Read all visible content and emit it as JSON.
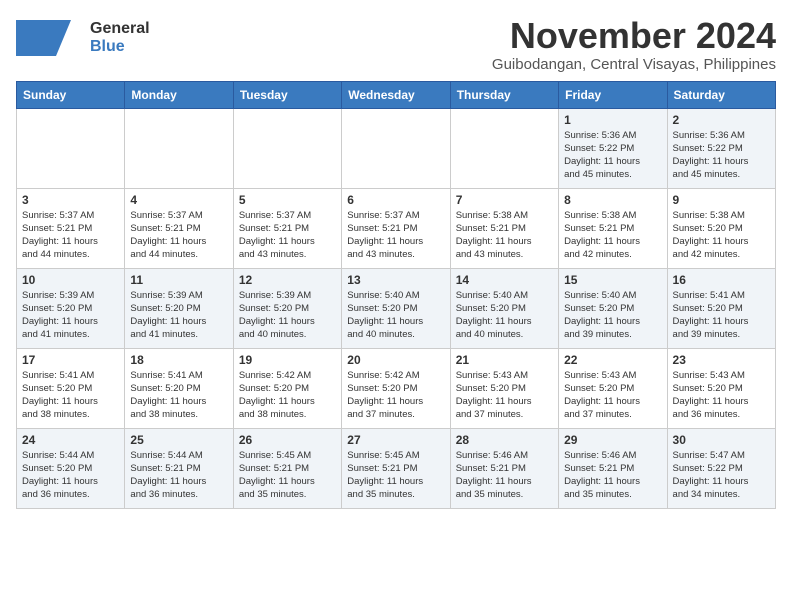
{
  "header": {
    "logo_general": "General",
    "logo_blue": "Blue",
    "month_title": "November 2024",
    "location": "Guibodangan, Central Visayas, Philippines"
  },
  "calendar": {
    "weekdays": [
      "Sunday",
      "Monday",
      "Tuesday",
      "Wednesday",
      "Thursday",
      "Friday",
      "Saturday"
    ],
    "weeks": [
      [
        {
          "day": "",
          "info": ""
        },
        {
          "day": "",
          "info": ""
        },
        {
          "day": "",
          "info": ""
        },
        {
          "day": "",
          "info": ""
        },
        {
          "day": "",
          "info": ""
        },
        {
          "day": "1",
          "info": "Sunrise: 5:36 AM\nSunset: 5:22 PM\nDaylight: 11 hours\nand 45 minutes."
        },
        {
          "day": "2",
          "info": "Sunrise: 5:36 AM\nSunset: 5:22 PM\nDaylight: 11 hours\nand 45 minutes."
        }
      ],
      [
        {
          "day": "3",
          "info": "Sunrise: 5:37 AM\nSunset: 5:21 PM\nDaylight: 11 hours\nand 44 minutes."
        },
        {
          "day": "4",
          "info": "Sunrise: 5:37 AM\nSunset: 5:21 PM\nDaylight: 11 hours\nand 44 minutes."
        },
        {
          "day": "5",
          "info": "Sunrise: 5:37 AM\nSunset: 5:21 PM\nDaylight: 11 hours\nand 43 minutes."
        },
        {
          "day": "6",
          "info": "Sunrise: 5:37 AM\nSunset: 5:21 PM\nDaylight: 11 hours\nand 43 minutes."
        },
        {
          "day": "7",
          "info": "Sunrise: 5:38 AM\nSunset: 5:21 PM\nDaylight: 11 hours\nand 43 minutes."
        },
        {
          "day": "8",
          "info": "Sunrise: 5:38 AM\nSunset: 5:21 PM\nDaylight: 11 hours\nand 42 minutes."
        },
        {
          "day": "9",
          "info": "Sunrise: 5:38 AM\nSunset: 5:20 PM\nDaylight: 11 hours\nand 42 minutes."
        }
      ],
      [
        {
          "day": "10",
          "info": "Sunrise: 5:39 AM\nSunset: 5:20 PM\nDaylight: 11 hours\nand 41 minutes."
        },
        {
          "day": "11",
          "info": "Sunrise: 5:39 AM\nSunset: 5:20 PM\nDaylight: 11 hours\nand 41 minutes."
        },
        {
          "day": "12",
          "info": "Sunrise: 5:39 AM\nSunset: 5:20 PM\nDaylight: 11 hours\nand 40 minutes."
        },
        {
          "day": "13",
          "info": "Sunrise: 5:40 AM\nSunset: 5:20 PM\nDaylight: 11 hours\nand 40 minutes."
        },
        {
          "day": "14",
          "info": "Sunrise: 5:40 AM\nSunset: 5:20 PM\nDaylight: 11 hours\nand 40 minutes."
        },
        {
          "day": "15",
          "info": "Sunrise: 5:40 AM\nSunset: 5:20 PM\nDaylight: 11 hours\nand 39 minutes."
        },
        {
          "day": "16",
          "info": "Sunrise: 5:41 AM\nSunset: 5:20 PM\nDaylight: 11 hours\nand 39 minutes."
        }
      ],
      [
        {
          "day": "17",
          "info": "Sunrise: 5:41 AM\nSunset: 5:20 PM\nDaylight: 11 hours\nand 38 minutes."
        },
        {
          "day": "18",
          "info": "Sunrise: 5:41 AM\nSunset: 5:20 PM\nDaylight: 11 hours\nand 38 minutes."
        },
        {
          "day": "19",
          "info": "Sunrise: 5:42 AM\nSunset: 5:20 PM\nDaylight: 11 hours\nand 38 minutes."
        },
        {
          "day": "20",
          "info": "Sunrise: 5:42 AM\nSunset: 5:20 PM\nDaylight: 11 hours\nand 37 minutes."
        },
        {
          "day": "21",
          "info": "Sunrise: 5:43 AM\nSunset: 5:20 PM\nDaylight: 11 hours\nand 37 minutes."
        },
        {
          "day": "22",
          "info": "Sunrise: 5:43 AM\nSunset: 5:20 PM\nDaylight: 11 hours\nand 37 minutes."
        },
        {
          "day": "23",
          "info": "Sunrise: 5:43 AM\nSunset: 5:20 PM\nDaylight: 11 hours\nand 36 minutes."
        }
      ],
      [
        {
          "day": "24",
          "info": "Sunrise: 5:44 AM\nSunset: 5:20 PM\nDaylight: 11 hours\nand 36 minutes."
        },
        {
          "day": "25",
          "info": "Sunrise: 5:44 AM\nSunset: 5:21 PM\nDaylight: 11 hours\nand 36 minutes."
        },
        {
          "day": "26",
          "info": "Sunrise: 5:45 AM\nSunset: 5:21 PM\nDaylight: 11 hours\nand 35 minutes."
        },
        {
          "day": "27",
          "info": "Sunrise: 5:45 AM\nSunset: 5:21 PM\nDaylight: 11 hours\nand 35 minutes."
        },
        {
          "day": "28",
          "info": "Sunrise: 5:46 AM\nSunset: 5:21 PM\nDaylight: 11 hours\nand 35 minutes."
        },
        {
          "day": "29",
          "info": "Sunrise: 5:46 AM\nSunset: 5:21 PM\nDaylight: 11 hours\nand 35 minutes."
        },
        {
          "day": "30",
          "info": "Sunrise: 5:47 AM\nSunset: 5:22 PM\nDaylight: 11 hours\nand 34 minutes."
        }
      ]
    ]
  }
}
